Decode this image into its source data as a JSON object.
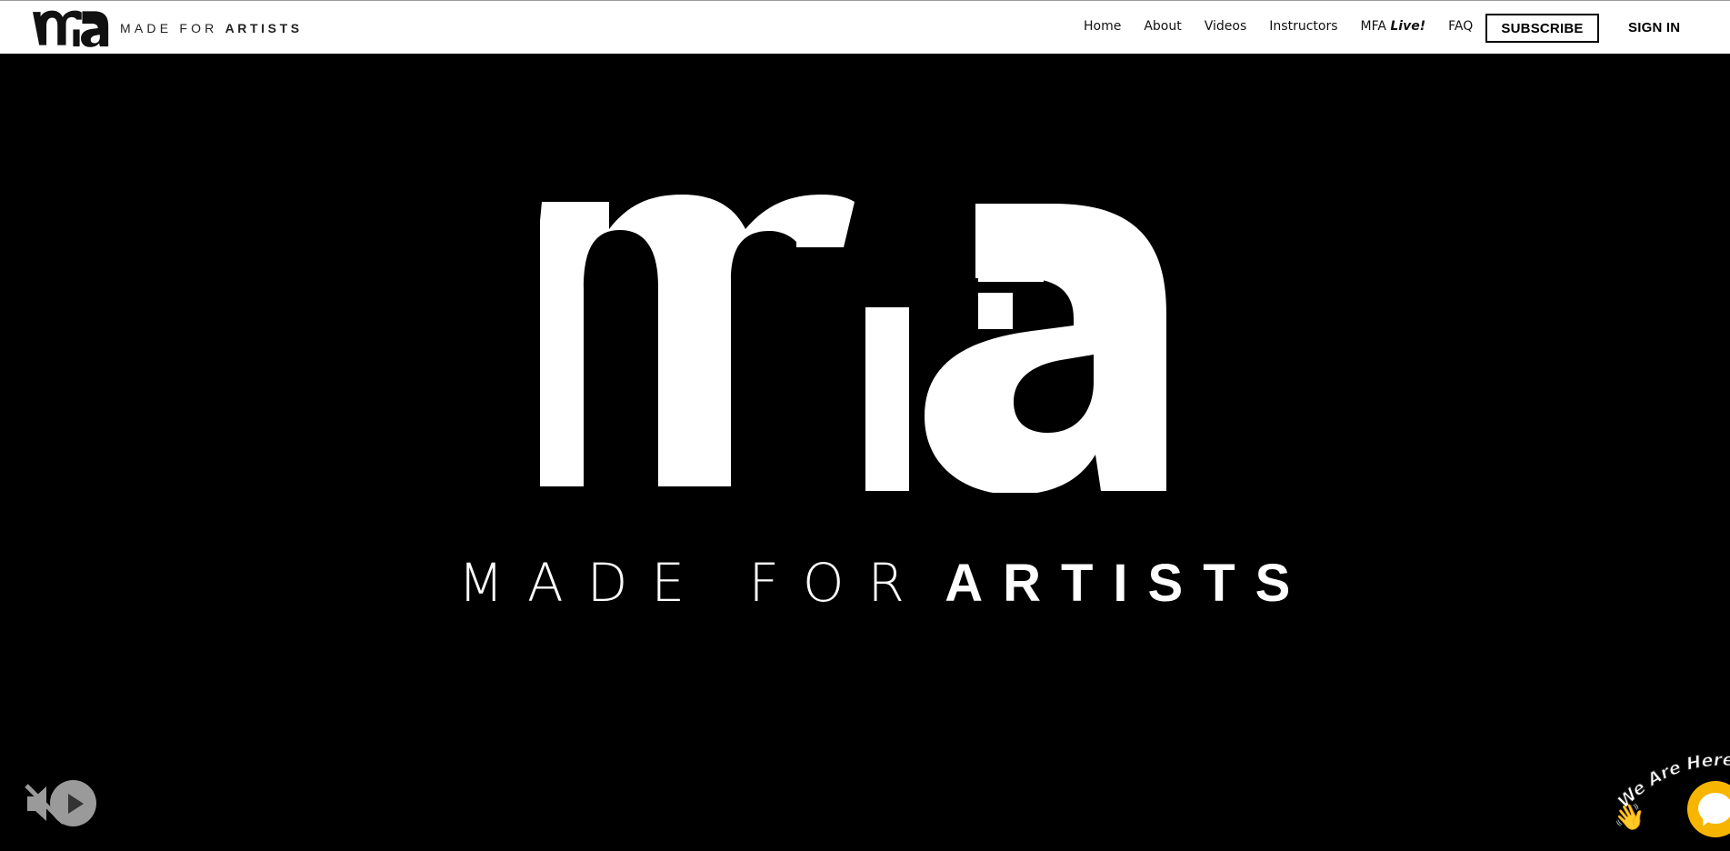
{
  "header": {
    "logo_text_light": "MADE FOR",
    "logo_text_bold": "ARTISTS",
    "nav": [
      {
        "label": "Home"
      },
      {
        "label": "About"
      },
      {
        "label": "Videos"
      },
      {
        "label": "Instructors"
      },
      {
        "label": "MFA",
        "label_em": "Live!"
      },
      {
        "label": "FAQ"
      }
    ],
    "subscribe_label": "SUBSCRIBE",
    "signin_label": "SIGN IN"
  },
  "hero": {
    "tagline_light": "MADE FOR",
    "tagline_bold": "ARTISTS"
  },
  "video_controls": {
    "mute_icon": "speaker-muted-icon",
    "play_icon": "play-icon"
  },
  "chat": {
    "badge_text": "We Are Here!",
    "wave_icon": "👋",
    "accent": "#f7b500"
  },
  "colors": {
    "header_bg": "#ffffff",
    "hero_bg": "#000000",
    "text_dark": "#111111"
  }
}
